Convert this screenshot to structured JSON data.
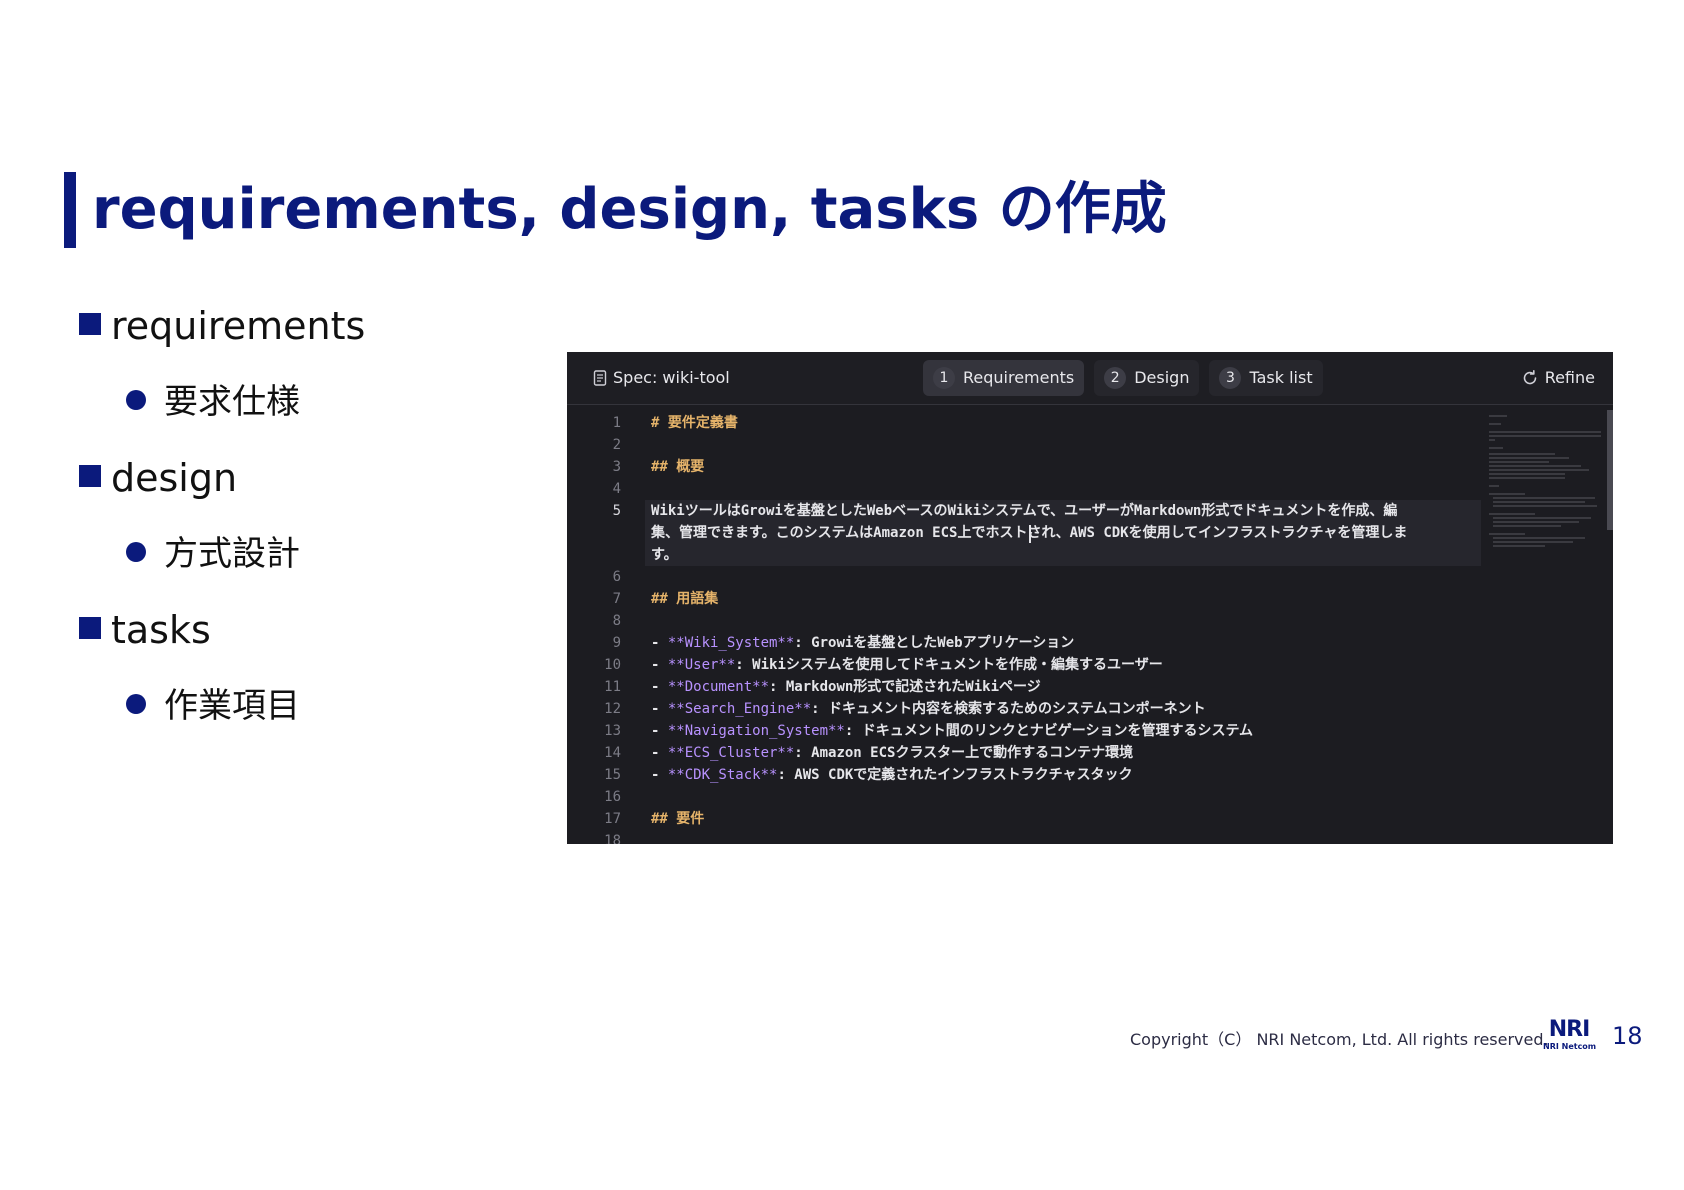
{
  "slide": {
    "title": "requirements, design, tasks の作成",
    "bullets": [
      {
        "label": "requirements",
        "sub": "要求仕様"
      },
      {
        "label": "design",
        "sub": "方式設計"
      },
      {
        "label": "tasks",
        "sub": "作業項目"
      }
    ]
  },
  "editor": {
    "spec_label": "Spec: wiki-tool",
    "tabs": [
      {
        "num": "1",
        "label": "Requirements",
        "active": true
      },
      {
        "num": "2",
        "label": "Design",
        "active": false
      },
      {
        "num": "3",
        "label": "Task list",
        "active": false
      }
    ],
    "refine_label": "Refine",
    "lines": [
      {
        "n": "1",
        "segments": [
          {
            "t": "# 要件定義書",
            "s": "h"
          }
        ]
      },
      {
        "n": "2",
        "segments": []
      },
      {
        "n": "3",
        "segments": [
          {
            "t": "## 概要",
            "s": "h"
          }
        ]
      },
      {
        "n": "4",
        "segments": []
      },
      {
        "n": "5",
        "segments": [
          {
            "t": "WikiツールはGrowiを基盤としたWebベースのWikiシステムで、ユーザーがMarkdown形式でドキュメントを作成、編",
            "s": ""
          }
        ]
      },
      {
        "n": "",
        "segments": [
          {
            "t": "集、管理できます。このシステムはAmazon ECS上でホストされ、AWS CDKを使用してインフラストラクチャを管理しま",
            "s": ""
          }
        ]
      },
      {
        "n": "",
        "segments": [
          {
            "t": "す。",
            "s": ""
          }
        ]
      },
      {
        "n": "6",
        "segments": []
      },
      {
        "n": "7",
        "segments": [
          {
            "t": "## 用語集",
            "s": "h"
          }
        ]
      },
      {
        "n": "8",
        "segments": []
      },
      {
        "n": "9",
        "segments": [
          {
            "t": "- ",
            "s": ""
          },
          {
            "t": "**Wiki_System**",
            "s": "b"
          },
          {
            "t": ": Growiを基盤としたWebアプリケーション",
            "s": ""
          }
        ]
      },
      {
        "n": "10",
        "segments": [
          {
            "t": "- ",
            "s": ""
          },
          {
            "t": "**User**",
            "s": "b"
          },
          {
            "t": ": Wikiシステムを使用してドキュメントを作成・編集するユーザー",
            "s": ""
          }
        ]
      },
      {
        "n": "11",
        "segments": [
          {
            "t": "- ",
            "s": ""
          },
          {
            "t": "**Document**",
            "s": "b"
          },
          {
            "t": ": Markdown形式で記述されたWikiページ",
            "s": ""
          }
        ]
      },
      {
        "n": "12",
        "segments": [
          {
            "t": "- ",
            "s": ""
          },
          {
            "t": "**Search_Engine**",
            "s": "b"
          },
          {
            "t": ": ドキュメント内容を検索するためのシステムコンポーネント",
            "s": ""
          }
        ]
      },
      {
        "n": "13",
        "segments": [
          {
            "t": "- ",
            "s": ""
          },
          {
            "t": "**Navigation_System**",
            "s": "b"
          },
          {
            "t": ": ドキュメント間のリンクとナビゲーションを管理するシステム",
            "s": ""
          }
        ]
      },
      {
        "n": "14",
        "segments": [
          {
            "t": "- ",
            "s": ""
          },
          {
            "t": "**ECS_Cluster**",
            "s": "b"
          },
          {
            "t": ": Amazon ECSクラスター上で動作するコンテナ環境",
            "s": ""
          }
        ]
      },
      {
        "n": "15",
        "segments": [
          {
            "t": "- ",
            "s": ""
          },
          {
            "t": "**CDK_Stack**",
            "s": "b"
          },
          {
            "t": ": AWS CDKで定義されたインフラストラクチャスタック",
            "s": ""
          }
        ]
      },
      {
        "n": "16",
        "segments": []
      },
      {
        "n": "17",
        "segments": [
          {
            "t": "## 要件",
            "s": "h"
          }
        ]
      },
      {
        "n": "18",
        "segments": []
      }
    ]
  },
  "footer": {
    "copyright": "Copyright（C） NRI Netcom, Ltd. All rights reserved.",
    "logo_main": "NRI",
    "logo_sub": "NRI Netcom",
    "page_number": "18"
  }
}
